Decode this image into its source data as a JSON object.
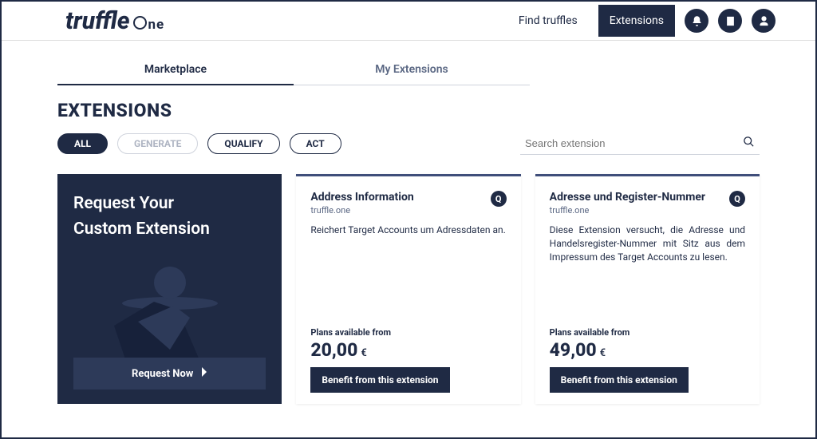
{
  "header": {
    "logo_main": "truffle",
    "logo_suffix": "ne",
    "nav": {
      "find": "Find truffles",
      "extensions": "Extensions"
    }
  },
  "tabs": {
    "marketplace": "Marketplace",
    "my_extensions": "My Extensions"
  },
  "page": {
    "title": "EXTENSIONS"
  },
  "filters": {
    "all": "ALL",
    "generate": "GENERATE",
    "qualify": "QUALIFY",
    "act": "ACT"
  },
  "search": {
    "placeholder": "Search extension"
  },
  "promo": {
    "line1": "Request Your",
    "line2": "Custom Extension",
    "cta": "Request Now"
  },
  "cards": [
    {
      "title": "Address Information",
      "vendor": "truffle.one",
      "badge": "Q",
      "description": "Reichert Target Accounts um Adressdaten an.",
      "plan_label": "Plans available from",
      "price": "20,00",
      "currency": "€",
      "cta": "Benefit from this extension",
      "justify": false
    },
    {
      "title": "Adresse und Register-Nummer",
      "vendor": "truffle.one",
      "badge": "Q",
      "description": "Diese Extension versucht, die Adresse und Handelsregister-Nummer mit Sitz aus dem Impressum des Target Accounts zu lesen.",
      "plan_label": "Plans available from",
      "price": "49,00",
      "currency": "€",
      "cta": "Benefit from this extension",
      "justify": true
    }
  ]
}
